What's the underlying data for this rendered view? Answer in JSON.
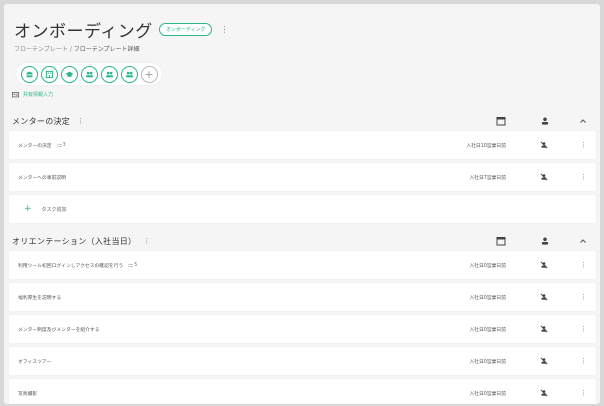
{
  "page": {
    "title": "オンボーディング",
    "badge": "オンボーディング",
    "breadcrumb": {
      "parent": "フローテンプレート",
      "separator": "/",
      "current": "フローテンプレート詳細"
    },
    "shared_info_label": "共有情報入力"
  },
  "icons": [
    "team-icon",
    "building-icon",
    "graduation-icon",
    "people-icon",
    "people-icon",
    "people-icon",
    "plus-icon"
  ],
  "colors": {
    "accent": "#2ab58c"
  },
  "sections": [
    {
      "title": "メンターの決定",
      "tasks": [
        {
          "name": "メンターの決定",
          "subtasks": "3",
          "due": "入社日10営業日前"
        },
        {
          "name": "メンターへの事前説明",
          "subtasks": "",
          "due": "入社日7営業日前"
        }
      ],
      "add_task_label": "タスク追加"
    },
    {
      "title": "オリエンテーション（入社当日）",
      "tasks": [
        {
          "name": "利用ツール初回ログインしアクセスの確認を行う",
          "subtasks": "5",
          "due": "入社日0営業日前"
        },
        {
          "name": "福利厚生を説明する",
          "subtasks": "",
          "due": "入社日0営業日前"
        },
        {
          "name": "メンター制度及びメンターを紹介する",
          "subtasks": "",
          "due": "入社日0営業日前"
        },
        {
          "name": "オフィスツアー",
          "subtasks": "",
          "due": "入社日0営業日前"
        },
        {
          "name": "写真撮影",
          "subtasks": "",
          "due": "入社日0営業日前"
        }
      ]
    }
  ]
}
